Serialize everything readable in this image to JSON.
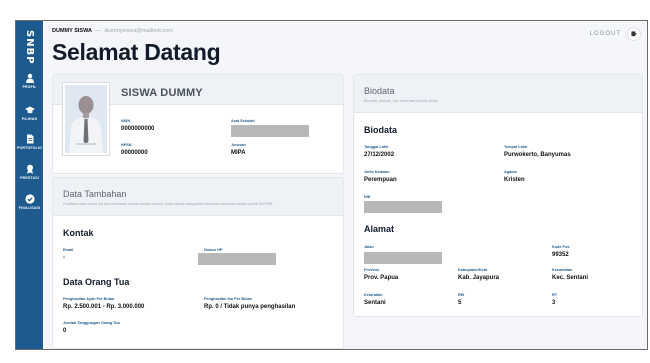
{
  "sidebar": {
    "brand": "SNBP",
    "items": [
      {
        "label": "PROFIL",
        "icon": "person-icon"
      },
      {
        "label": "PILIHAN",
        "icon": "graduation-cap-icon"
      },
      {
        "label": "PORTOFOLIO",
        "icon": "document-icon"
      },
      {
        "label": "PRESTASI",
        "icon": "award-icon"
      },
      {
        "label": "FINALISASI",
        "icon": "check-circle-icon"
      }
    ]
  },
  "topbar": {
    "user_name": "DUMMY SISWA",
    "separator": "—",
    "user_email": "dummysiswa@mailtest.com",
    "logout": "LOGOUT"
  },
  "page_title": "Selamat Datang",
  "profile": {
    "name": "SISWA DUMMY",
    "nisn_label": "NISN",
    "nisn": "0000000000",
    "npsn_label": "NPSN",
    "npsn": "00000000",
    "school_label": "Asal Sekolah",
    "jurusan_label": "Jurusan",
    "jurusan": "MIPA"
  },
  "data_tambahan": {
    "title": "Data Tambahan",
    "subtitle": "Pastikan data orang tua dan informasi kontak sudah sesuai. Anda dapat mengubah informasi tersebut melalui portal SNPMB.",
    "kontak_title": "Kontak",
    "email_label": "Email",
    "email": "-",
    "hp_label": "Nomor HP",
    "ortu_title": "Data Orang Tua",
    "ayah_label": "Penghasilan Ayah Per Bulan",
    "ayah": "Rp. 2.500.001 - Rp. 3.000.000",
    "ibu_label": "Penghasilan Ibu Per Bulan",
    "ibu": "Rp. 0 / Tidak punya penghasilan",
    "tanggungan_label": "Jumlah Tanggungan Orang Tua",
    "tanggungan": "0"
  },
  "biodata": {
    "header_title": "Biodata",
    "header_sub": "Biodata, alamat, dan informasi kontak Anda.",
    "section_title": "Biodata",
    "tgl_label": "Tanggal Lahir",
    "tgl": "27/12/2002",
    "tempat_label": "Tempat Lahir",
    "tempat": "Purwokerto, Banyumas",
    "jk_label": "Jenis Kelamin",
    "jk": "Perempuan",
    "agama_label": "Agama",
    "agama": "Kristen",
    "nik_label": "NIK",
    "alamat_title": "Alamat",
    "jalan_label": "Jalan",
    "kodepos_label": "Kode Pos",
    "kodepos": "99352",
    "provinsi_label": "Provinsi",
    "provinsi": "Prov. Papua",
    "kab_label": "Kabupaten/Kota",
    "kab": "Kab. Jayapura",
    "kec_label": "Kecamatan",
    "kec": "Kec. Sentani",
    "kel_label": "Kelurahan",
    "kel": "Sentani",
    "rw_label": "RW",
    "rw": "5",
    "rt_label": "RT",
    "rt": "3"
  }
}
